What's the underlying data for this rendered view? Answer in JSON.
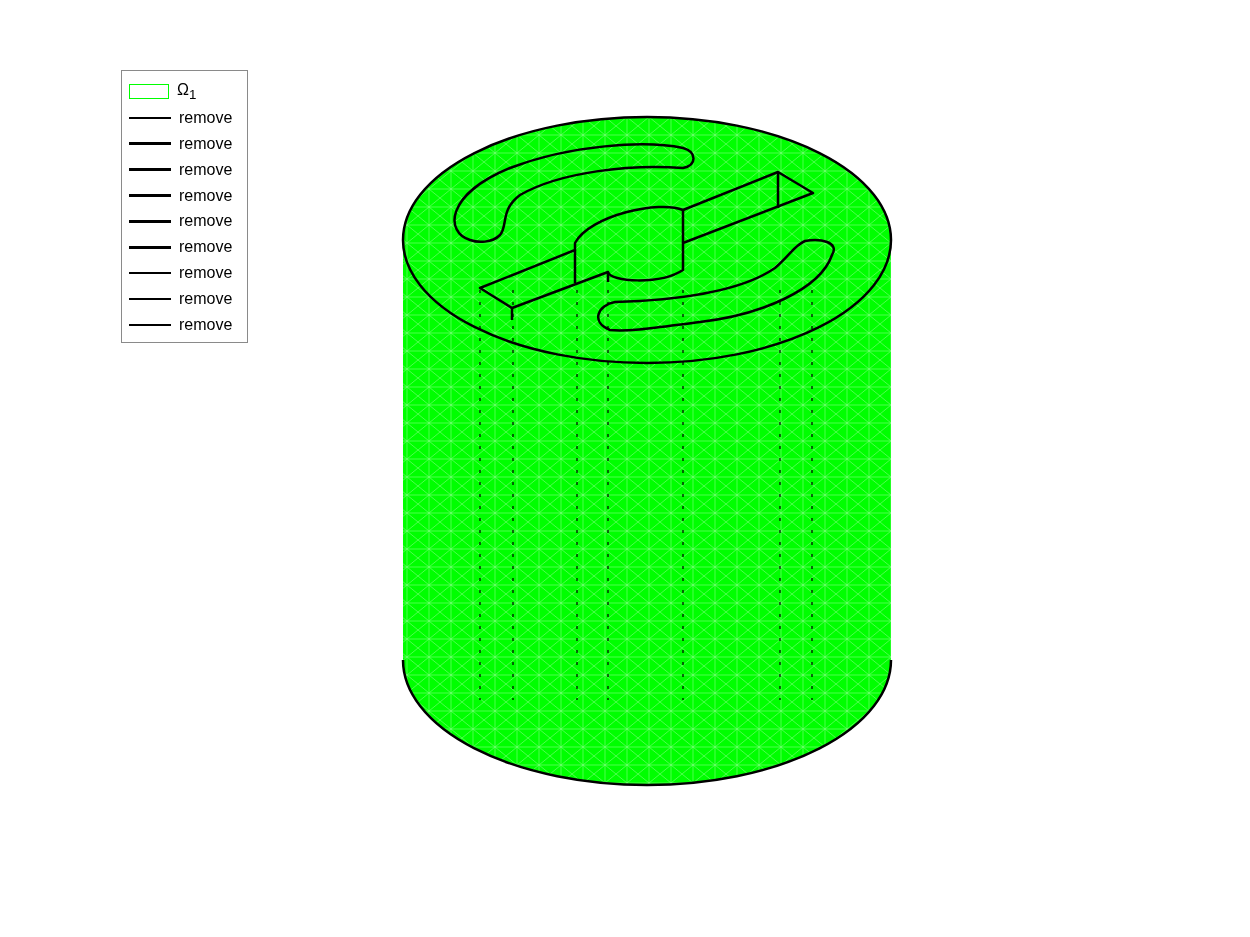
{
  "legend": {
    "items": [
      {
        "label": "Ω$_{1}$",
        "kind": "patch",
        "color": "#00ff00"
      },
      {
        "label": "remove",
        "kind": "line",
        "color": "#000000"
      },
      {
        "label": "remove",
        "kind": "line",
        "color": "#000000"
      },
      {
        "label": "remove",
        "kind": "line",
        "color": "#000000"
      },
      {
        "label": "remove",
        "kind": "line",
        "color": "#000000"
      },
      {
        "label": "remove",
        "kind": "line",
        "color": "#000000"
      },
      {
        "label": "remove",
        "kind": "line",
        "color": "#000000"
      },
      {
        "label": "remove",
        "kind": "line",
        "color": "#000000"
      },
      {
        "label": "remove",
        "kind": "line",
        "color": "#000000"
      },
      {
        "label": "remove",
        "kind": "line",
        "color": "#000000"
      }
    ]
  }
}
